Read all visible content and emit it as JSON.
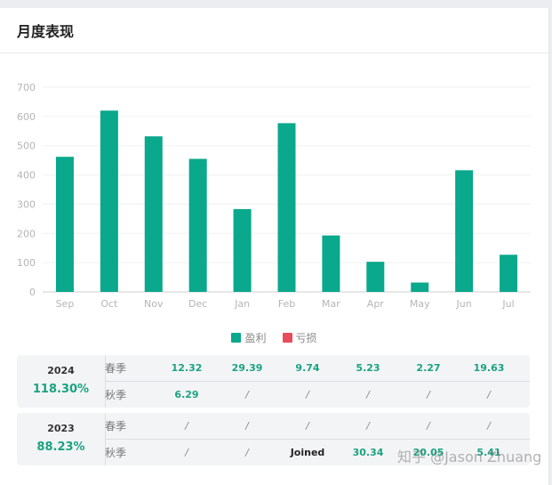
{
  "card": {
    "title": "月度表现"
  },
  "chart_data": {
    "type": "bar",
    "categories": [
      "Sep",
      "Oct",
      "Nov",
      "Dec",
      "Jan",
      "Feb",
      "Mar",
      "Apr",
      "May",
      "Jun",
      "Jul"
    ],
    "series": [
      {
        "name": "盈利",
        "values": [
          462,
          620,
          532,
          455,
          283,
          577,
          193,
          103,
          32,
          416,
          127
        ],
        "color": "#0aa88c"
      },
      {
        "name": "亏损",
        "values": [
          0,
          0,
          0,
          0,
          0,
          0,
          0,
          0,
          0,
          0,
          0
        ],
        "color": "#e84c5a"
      }
    ],
    "ylim": [
      0,
      700
    ],
    "yticks": [
      0,
      100,
      200,
      300,
      400,
      500,
      600,
      700
    ],
    "grid": true,
    "legend": "bottom-center",
    "title": "",
    "xlabel": "",
    "ylabel": ""
  },
  "legend": {
    "profit": "盈利",
    "loss": "亏损",
    "profit_color": "#0aa88c",
    "loss_color": "#e84c5a"
  },
  "returns_table": [
    {
      "year": "2024",
      "total": "118.30%",
      "rows": [
        {
          "label": "春季",
          "cells": [
            "12.32",
            "29.39",
            "9.74",
            "5.23",
            "2.27",
            "19.63"
          ]
        },
        {
          "label": "秋季",
          "cells": [
            "6.29",
            "/",
            "/",
            "/",
            "/",
            "/"
          ]
        }
      ]
    },
    {
      "year": "2023",
      "total": "88.23%",
      "rows": [
        {
          "label": "春季",
          "cells": [
            "/",
            "/",
            "/",
            "/",
            "/",
            "/"
          ]
        },
        {
          "label": "秋季",
          "cells": [
            "/",
            "/",
            "Joined",
            "30.34",
            "20.05",
            "5.41"
          ]
        }
      ]
    }
  ],
  "watermark": "知乎 @Jason Zhuang"
}
